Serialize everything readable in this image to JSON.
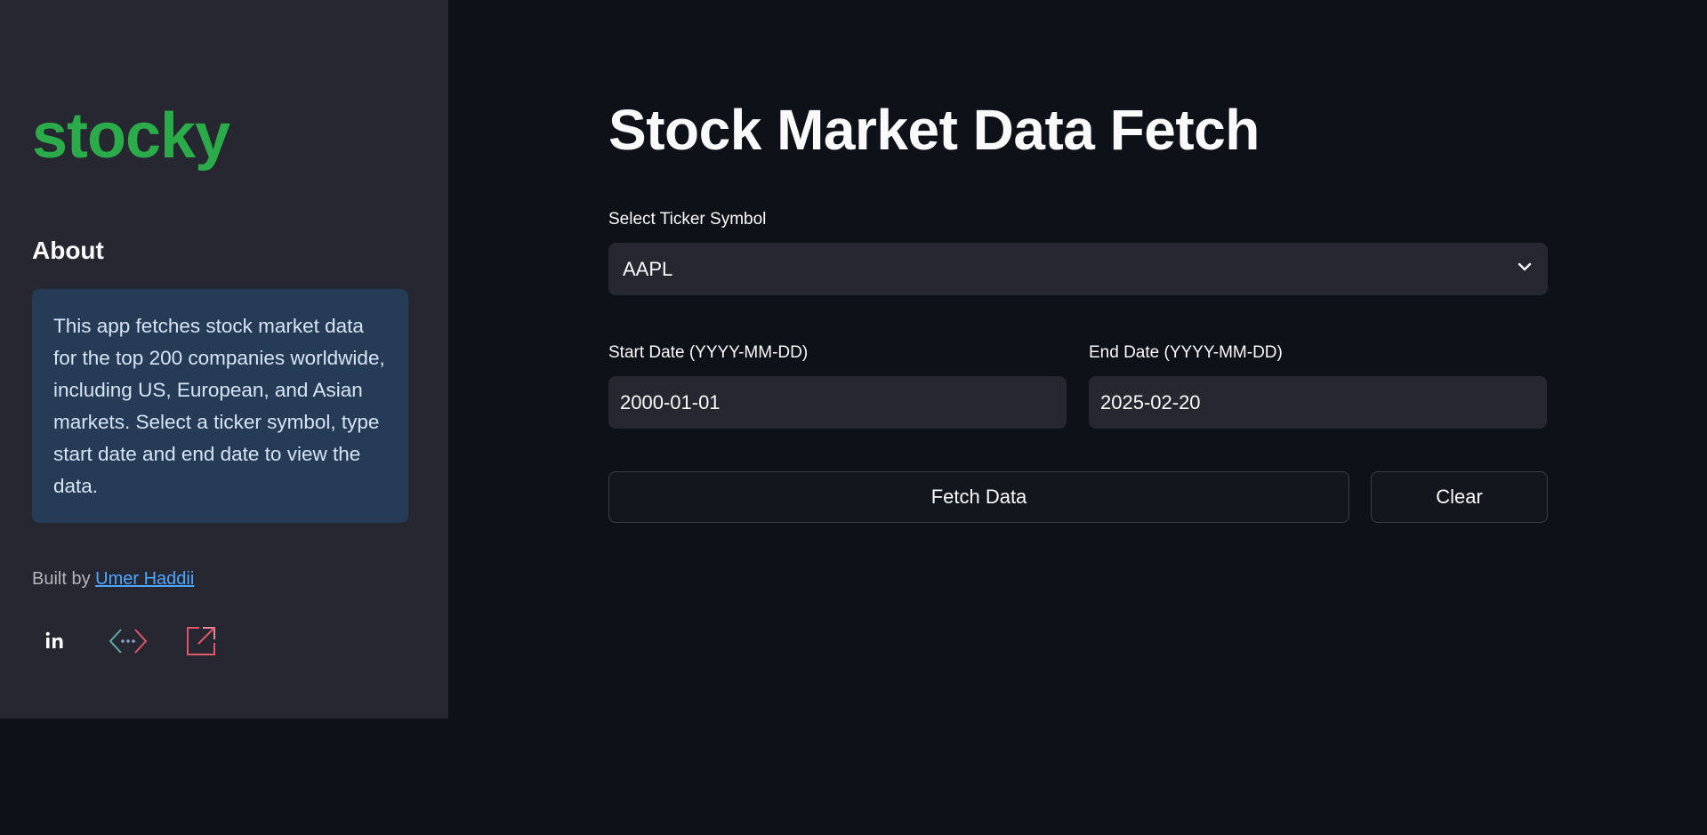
{
  "sidebar": {
    "brand": "stocky",
    "about_title": "About",
    "about_text": "This app fetches stock market data for the top 200 companies worldwide, including US, European, and Asian markets. Select a ticker symbol, type start date and end date to view the data.",
    "built_by_prefix": "Built by ",
    "author_link": "Umer Haddii",
    "social": [
      "linkedin-icon",
      "code-icon",
      "external-link-icon"
    ]
  },
  "main": {
    "title": "Stock Market Data Fetch",
    "ticker": {
      "label": "Select Ticker Symbol",
      "value": "AAPL"
    },
    "start_date": {
      "label": "Start Date (YYYY-MM-DD)",
      "value": "2000-01-01"
    },
    "end_date": {
      "label": "End Date (YYYY-MM-DD)",
      "value": "2025-02-20"
    },
    "fetch_label": "Fetch Data",
    "clear_label": "Clear"
  },
  "colors": {
    "background": "#0e1117",
    "sidebar": "#262730",
    "brand": "#2bab49",
    "info_box": "#263b55",
    "link": "#4ea6ff"
  }
}
